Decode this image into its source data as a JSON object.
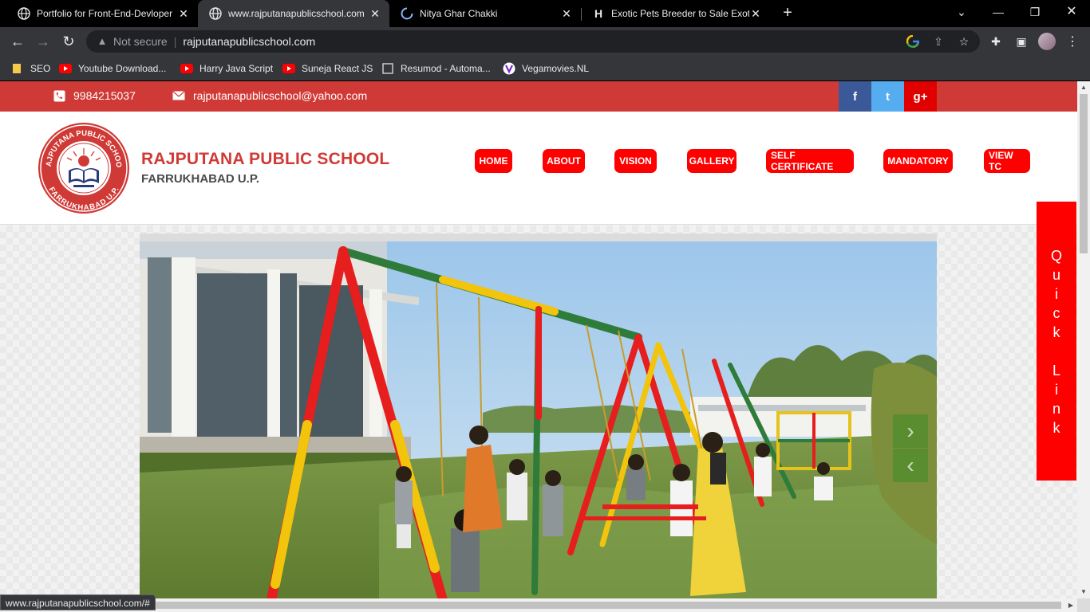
{
  "browser": {
    "tabs": [
      {
        "title": "Portfolio for Front-End-Devloper",
        "icon": "globe-icon"
      },
      {
        "title": "www.rajputanapublicschool.com",
        "icon": "globe-icon"
      },
      {
        "title": "Nitya Ghar Chakki",
        "icon": "loading-spinner-icon"
      },
      {
        "title": "Exotic Pets Breeder to Sale Exotic",
        "icon": "hash-icon"
      }
    ],
    "omnibox": {
      "security_label": "Not secure",
      "url": "rajputanapublicschool.com"
    },
    "bookmarks": [
      {
        "label": "SEO",
        "icon": "folder-icon"
      },
      {
        "label": "Youtube Download...",
        "icon": "youtube-icon"
      },
      {
        "label": "Harry Java Script",
        "icon": "youtube-icon"
      },
      {
        "label": "Suneja React JS",
        "icon": "youtube-icon"
      },
      {
        "label": "Resumod - Automa...",
        "icon": "resumod-icon"
      },
      {
        "label": "Vegamovies.NL",
        "icon": "vegamovies-icon"
      }
    ],
    "status_url": "www.rajputanapublicschool.com/#"
  },
  "site": {
    "topbar": {
      "phone": "9984215037",
      "email": "rajputanapublicschool@yahoo.com",
      "social": [
        {
          "label": "f",
          "color": "#3b5998"
        },
        {
          "label": "t",
          "color": "#55acee"
        },
        {
          "label": "g+",
          "color": "#e00000"
        }
      ]
    },
    "header": {
      "name": "RAJPUTANA PUBLIC SCHOOL",
      "location": "FARRUKHABAD U.P.",
      "logo_text_top": "RAJPUTANA PUBLIC SCHOOL",
      "logo_text_bottom": "FARRUKHABAD U.P."
    },
    "menu": [
      "HOME",
      "ABOUT",
      "VISION",
      "GALLERY",
      "SELF CERTIFICATE",
      "MANDATORY",
      "VIEW TC"
    ],
    "quick_link": [
      "Q",
      "u",
      "i",
      "c",
      "k",
      "",
      "L",
      "i",
      "n",
      "k"
    ],
    "slider": {
      "image_subject": "children playing on swings in school garden"
    },
    "colors": {
      "brand_red": "#d03a36",
      "menu_red": "#ff0000"
    }
  }
}
